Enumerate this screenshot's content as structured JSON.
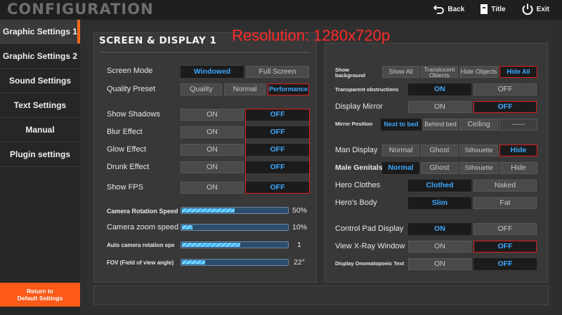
{
  "header": {
    "title": "CONFIGURATION",
    "nav": {
      "back": "Back",
      "title_btn": "Title",
      "exit": "Exit"
    }
  },
  "overlay": {
    "resolution": "Resolution: 1280x720p"
  },
  "sidebar": {
    "items": [
      {
        "label": "Graphic Settings 1",
        "active": true
      },
      {
        "label": "Graphic Settings 2",
        "active": false
      },
      {
        "label": "Sound Settings",
        "active": false
      },
      {
        "label": "Text Settings",
        "active": false
      },
      {
        "label": "Manual",
        "active": false
      },
      {
        "label": "Plugin settings",
        "active": false
      }
    ],
    "reset_line1": "Return to",
    "reset_line2": "Default Settings"
  },
  "left_panel": {
    "title": "SCREEN & DISPLAY 1",
    "screen_mode": {
      "label": "Screen Mode",
      "options": [
        "Windowed",
        "Full Screen"
      ],
      "selected": "Windowed"
    },
    "quality_preset": {
      "label": "Quality Preset",
      "options": [
        "Quality",
        "Normal",
        "Performance"
      ],
      "selected": "Performance"
    },
    "toggles": [
      {
        "label": "Show Shadows",
        "on": "ON",
        "off": "OFF",
        "selected": "OFF"
      },
      {
        "label": "Blur Effect",
        "on": "ON",
        "off": "OFF",
        "selected": "OFF"
      },
      {
        "label": "Glow Effect",
        "on": "ON",
        "off": "OFF",
        "selected": "OFF"
      },
      {
        "label": "Drunk Effect",
        "on": "ON",
        "off": "OFF",
        "selected": "OFF"
      },
      {
        "label": "Show FPS",
        "on": "ON",
        "off": "OFF",
        "selected": "OFF"
      }
    ],
    "sliders": [
      {
        "label": "Camera Rotation Speed",
        "value": 50,
        "display": "50%"
      },
      {
        "label": "Camera zoom speed",
        "value": 10,
        "display": "10%"
      },
      {
        "label": "Auto camera rotation spe",
        "value": 55,
        "display": "1"
      },
      {
        "label": "FOV (Field of view angle)",
        "value": 22,
        "display": "22°"
      }
    ]
  },
  "right_panel": {
    "show_background": {
      "label_line1": "Show",
      "label_line2": "background",
      "options": [
        "Show All",
        "Translucent Objects",
        "Hide Objects",
        "Hide All"
      ],
      "selected": "Hide All"
    },
    "transparent_obstructions": {
      "label": "Transparent obstructions",
      "options": [
        "ON",
        "OFF"
      ],
      "selected": "ON"
    },
    "display_mirror": {
      "label": "Display Mirror",
      "options": [
        "ON",
        "OFF"
      ],
      "selected": "OFF"
    },
    "mirror_position": {
      "label": "Mirror Position",
      "options": [
        "Next to bed",
        "Behind bed",
        "Ceiling",
        "------"
      ],
      "selected": "Next to bed"
    },
    "man_display": {
      "label": "Man Display",
      "options": [
        "Normal",
        "Ghost",
        "Silhouette",
        "Hide"
      ],
      "selected": "Hide"
    },
    "male_genitals": {
      "label": "Male Genitals",
      "options": [
        "Normal",
        "Ghost",
        "Silhouette",
        "Hide"
      ],
      "selected": "Normal"
    },
    "hero_clothes": {
      "label": "Hero Clothes",
      "options": [
        "Clothed",
        "Naked"
      ],
      "selected": "Clothed"
    },
    "hero_body": {
      "label": "Hero's Body",
      "options": [
        "Slim",
        "Fat"
      ],
      "selected": "Slim"
    },
    "control_pad_display": {
      "label": "Control Pad Display",
      "options": [
        "ON",
        "OFF"
      ],
      "selected": "ON"
    },
    "view_xray_window": {
      "label": "View X-Ray Window",
      "options": [
        "ON",
        "OFF"
      ],
      "selected": "OFF"
    },
    "display_onomatopoeic": {
      "label": "Display Onomatopoeic Text",
      "options": [
        "ON",
        "OFF"
      ],
      "selected": "OFF"
    }
  },
  "colors": {
    "accent": "#3da8ff",
    "highlight": "#e02020",
    "sidebar_active": "#ff6a1a",
    "reset_button": "#ff5a1a"
  },
  "icons": {
    "back": "back-arrow-icon",
    "title": "title-card-icon",
    "exit": "power-icon"
  }
}
